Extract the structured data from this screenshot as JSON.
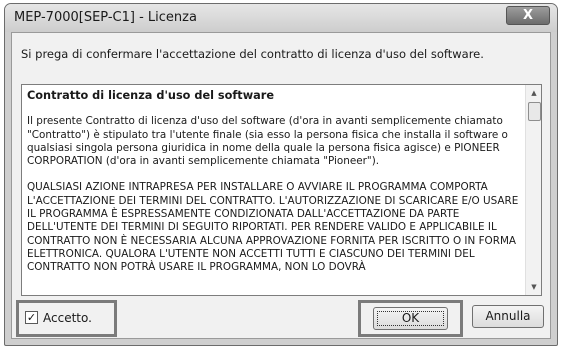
{
  "window": {
    "title": "MEP-7000[SEP-C1] - Licenza",
    "close_glyph": "X"
  },
  "prompt": "Si prega di confermare l'accettazione del contratto di licenza d'uso del software.",
  "licence": {
    "heading": "Contratto di licenza d'uso del software",
    "paragraphs": [
      "Il presente Contratto di licenza d'uso del software (d'ora in avanti semplicemente chiamato \"Contratto\") è stipulato tra l'utente finale (sia esso la persona fisica che installa il software o qualsiasi singola persona giuridica in nome della quale la persona fisica agisce) e PIONEER CORPORATION (d'ora in avanti semplicemente chiamata \"Pioneer\").",
      "QUALSIASI AZIONE INTRAPRESA PER INSTALLARE O AVVIARE IL PROGRAMMA COMPORTA L'ACCETTAZIONE DEI TERMINI DEL CONTRATTO. L'AUTORIZZAZIONE DI SCARICARE E/O USARE IL PROGRAMMA È ESPRESSAMENTE CONDIZIONATA DALL'ACCETTAZIONE DA PARTE DELL'UTENTE DEI TERMINI DI SEGUITO RIPORTATI. PER RENDERE VALIDO E APPLICABILE IL CONTRATTO NON È NECESSARIA ALCUNA APPROVAZIONE FORNITA PER ISCRITTO O IN FORMA ELETTRONICA. QUALORA L'UTENTE NON ACCETTI TUTTI E CIASCUNO DEI TERMINI DEL CONTRATTO NON POTRÀ USARE IL PROGRAMMA, NON LO DOVRÀ"
    ]
  },
  "accept": {
    "label": "Accetto.",
    "checked": true,
    "check_glyph": "✓"
  },
  "buttons": {
    "ok": "OK",
    "cancel": "Annulla"
  },
  "icons": {
    "close": "close-icon",
    "scroll_up": "scroll-up-arrow-icon",
    "scroll_down": "scroll-down-arrow-icon",
    "checkmark": "checkmark-icon"
  },
  "colors": {
    "dialog_background": "#f1f1f1",
    "highlight_frame": "#7b7b7b"
  }
}
